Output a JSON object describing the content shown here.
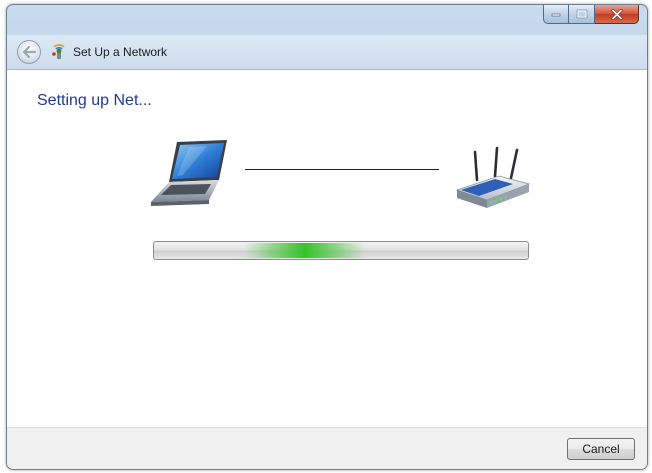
{
  "window": {
    "title": "Set Up a Network",
    "heading": "Setting up Net..."
  },
  "progress": {
    "state": "indeterminate",
    "color": "#36c22a"
  },
  "footer": {
    "cancel_label": "Cancel"
  },
  "icons": {
    "back": "back-arrow-icon",
    "app": "network-setup-icon",
    "laptop": "laptop-icon",
    "router": "router-icon"
  },
  "colors": {
    "heading": "#1f3a93",
    "close_button": "#c23b1f"
  }
}
